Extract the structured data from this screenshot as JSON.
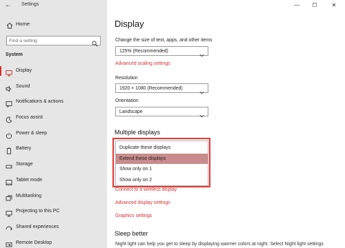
{
  "app": {
    "title": "Settings"
  },
  "window_controls": {
    "minimize": "—",
    "maximize": "☐",
    "close": "✕"
  },
  "sidebar": {
    "home_label": "Home",
    "search_placeholder": "Find a setting",
    "section_label": "System",
    "items": [
      {
        "label": "Display",
        "icon": "monitor-icon",
        "selected": true
      },
      {
        "label": "Sound",
        "icon": "speaker-icon"
      },
      {
        "label": "Notifications & actions",
        "icon": "notification-icon"
      },
      {
        "label": "Focus assist",
        "icon": "moon-icon"
      },
      {
        "label": "Power & sleep",
        "icon": "power-icon"
      },
      {
        "label": "Battery",
        "icon": "battery-icon"
      },
      {
        "label": "Storage",
        "icon": "storage-icon"
      },
      {
        "label": "Tablet mode",
        "icon": "tablet-icon"
      },
      {
        "label": "Multitasking",
        "icon": "multitasking-icon"
      },
      {
        "label": "Projecting to this PC",
        "icon": "projector-icon"
      },
      {
        "label": "Shared experiences",
        "icon": "shared-icon"
      },
      {
        "label": "Remote Desktop",
        "icon": "remote-desktop-icon"
      }
    ]
  },
  "main": {
    "title": "Display",
    "scale": {
      "label": "Change the size of text, apps, and other items",
      "value": "125% (Recommended)",
      "link": "Advanced scaling settings"
    },
    "resolution": {
      "label": "Resolution",
      "value": "1920 × 1080 (Recommended)"
    },
    "orientation": {
      "label": "Orientation",
      "value": "Landscape"
    },
    "multiple_displays": {
      "heading": "Multiple displays",
      "options": [
        "Duplicate these displays",
        "Extend these displays",
        "Show only on 1",
        "Show only on 2"
      ],
      "selected_option": "Extend these displays",
      "wireless_link": "Connect to a wireless display",
      "advanced_link": "Advanced display settings",
      "graphics_link": "Graphics settings"
    },
    "sleep": {
      "heading": "Sleep better",
      "text": "Night light can help you get to sleep by displaying warmer colors at night. Select Night light settings"
    }
  },
  "colors": {
    "accent": "#d32f2f",
    "highlight_border": "#e53935",
    "selected_option_bg": "#c88c8c",
    "sidebar_bg": "#e6e6e6"
  }
}
